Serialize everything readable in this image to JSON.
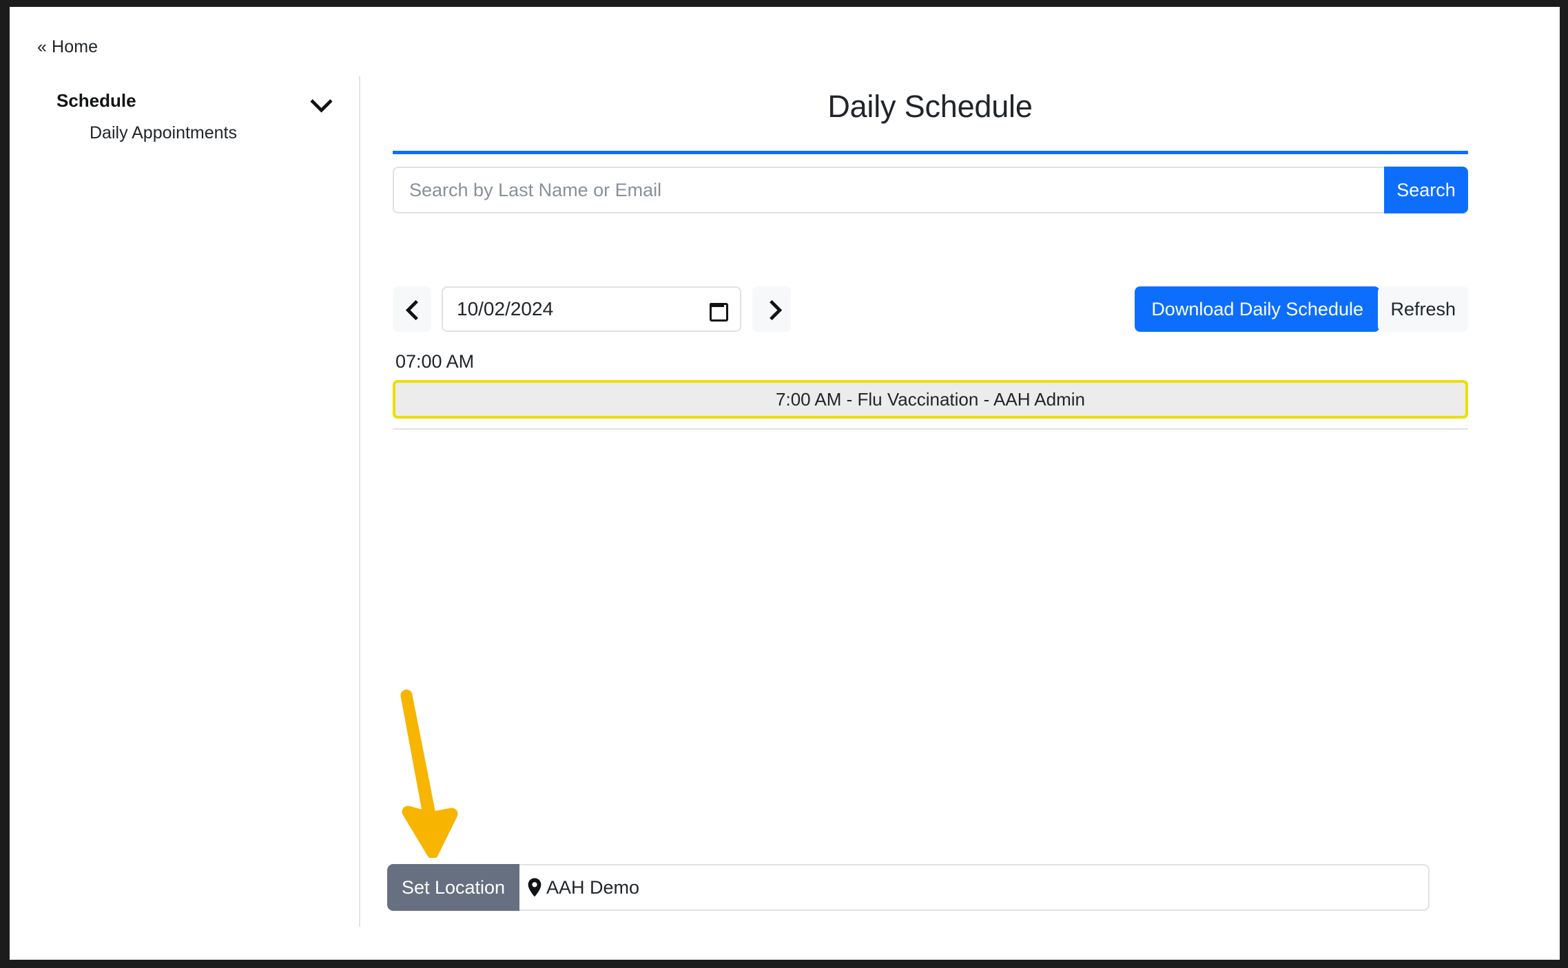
{
  "breadcrumb": {
    "label": "« Home"
  },
  "sidebar": {
    "group_label": "Schedule",
    "group_icon": "chevron-down-icon",
    "items": [
      {
        "label": "Daily Appointments"
      }
    ]
  },
  "main": {
    "title": "Daily Schedule",
    "accent_color": "#0d6efd"
  },
  "search": {
    "placeholder": "Search by Last Name or Email",
    "value": "",
    "button_label": "Search"
  },
  "date_nav": {
    "prev_icon": "chevron-left-icon",
    "next_icon": "chevron-right-icon",
    "date_value": "10/02/2024",
    "calendar_icon": "calendar-icon",
    "download_label": "Download Daily Schedule",
    "refresh_label": "Refresh"
  },
  "schedule": {
    "slots": [
      {
        "time_label": "07:00 AM",
        "appointments": [
          {
            "label": "7:00 AM - Flu Vaccination - AAH Admin"
          }
        ]
      }
    ]
  },
  "annotation": {
    "type": "arrow",
    "color": "#f7b500",
    "points_to": "set-location-button"
  },
  "location": {
    "button_label": "Set Location",
    "pin_icon": "map-pin-icon",
    "name": "AAH Demo"
  }
}
